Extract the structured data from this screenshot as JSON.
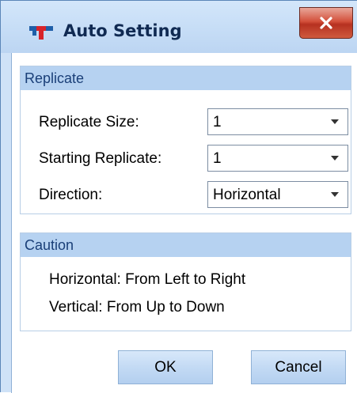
{
  "window": {
    "title": "Auto Setting",
    "close_icon": "close-x-icon",
    "logo_icon": "app-logo-icon",
    "accent_color": "#cfe2f7",
    "close_color": "#c8412c"
  },
  "replicate": {
    "header": "Replicate",
    "size": {
      "label": "Replicate Size:",
      "value": "1"
    },
    "start": {
      "label": "Starting Replicate:",
      "value": "1"
    },
    "direction": {
      "label": "Direction:",
      "value": "Horizontal"
    },
    "dropdown_icon": "chevron-down-icon"
  },
  "caution": {
    "header": "Caution",
    "lines": [
      "Horizontal: From Left to Right",
      "Vertical: From Up to Down"
    ]
  },
  "buttons": {
    "ok": "OK",
    "cancel": "Cancel"
  }
}
